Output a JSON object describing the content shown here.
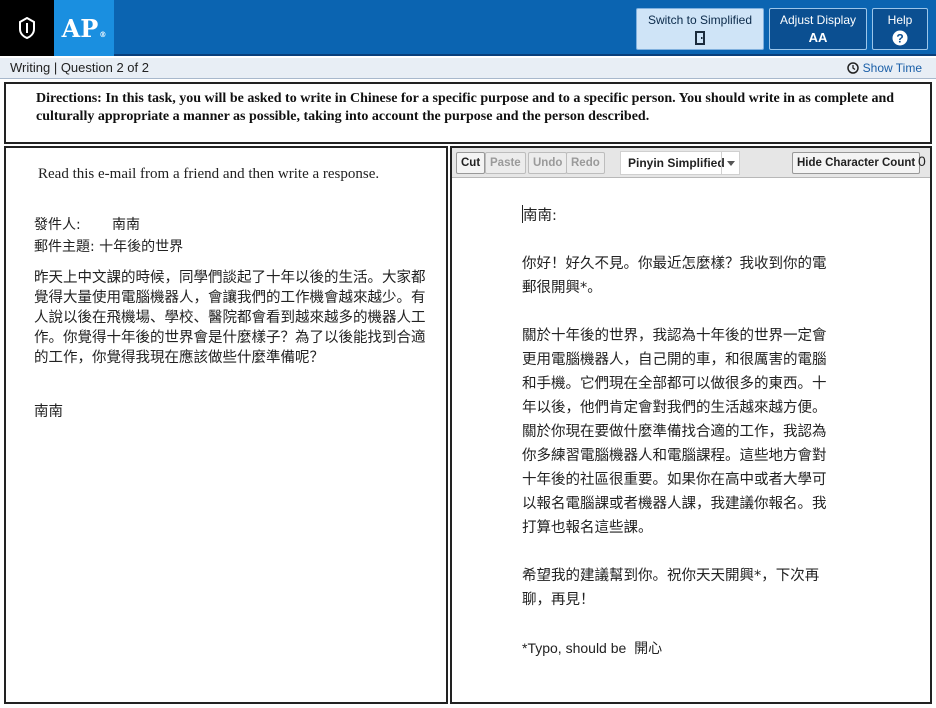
{
  "header": {
    "logo_text": "AP",
    "logo_reg": "®",
    "switch_label": "Switch to Simplified",
    "adjust_label": "Adjust Display",
    "adjust_icon_text": "AA",
    "help_label": "Help"
  },
  "subheader": {
    "question_label": "Writing | Question 2 of 2",
    "show_time": "Show Time"
  },
  "directions": "Directions: In this task, you will be asked to write in Chinese for a specific purpose and to a specific person. You should write in as complete and culturally appropriate a manner as possible, taking into account the purpose and the person described.",
  "prompt": {
    "instruction": "Read this e-mail from a friend and then write a response.",
    "from_label": "發件人:",
    "from_value": "南南",
    "subject_label": "郵件主題:",
    "subject_value": "十年後的世界",
    "body": "昨天上中文課的時候，同學們談起了十年以後的生活。大家都覺得大量使用電腦機器人，會讓我們的工作機會越來越少。有人說以後在飛機場、學校、醫院都會看到越來越多的機器人工作。你覺得十年後的世界會是什麼樣子？為了以後能找到合適的工作，你覺得我現在應該做些什麼準備呢？",
    "signature": "南南"
  },
  "toolbar": {
    "cut": "Cut",
    "paste": "Paste",
    "undo": "Undo",
    "redo": "Redo",
    "ime": "Pinyin Simplified",
    "hide_count": "Hide Character Count",
    "count": "0"
  },
  "response": {
    "greeting": "南南:",
    "p1": "你好！好久不見。你最近怎麼樣？我收到你的電郵很開興*。",
    "p2": "關於十年後的世界，我認為十年後的世界一定會更用電腦機器人，自己開的車，和很厲害的電腦和手機。它們現在全部都可以做很多的東西。十年以後，他們肯定會對我們的生活越來越方便。關於你現在要做什麼準備找合適的工作，我認為你多練習電腦機器人和電腦課程。這些地方會對十年後的社區很重要。如果你在高中或者大學可以報名電腦課或者機器人課，我建議你報名。我打算也報名這些課。",
    "p3": "希望我的建議幫到你。祝你天天開興*，下次再聊，再見！",
    "note": "*Typo, should be  開心"
  }
}
